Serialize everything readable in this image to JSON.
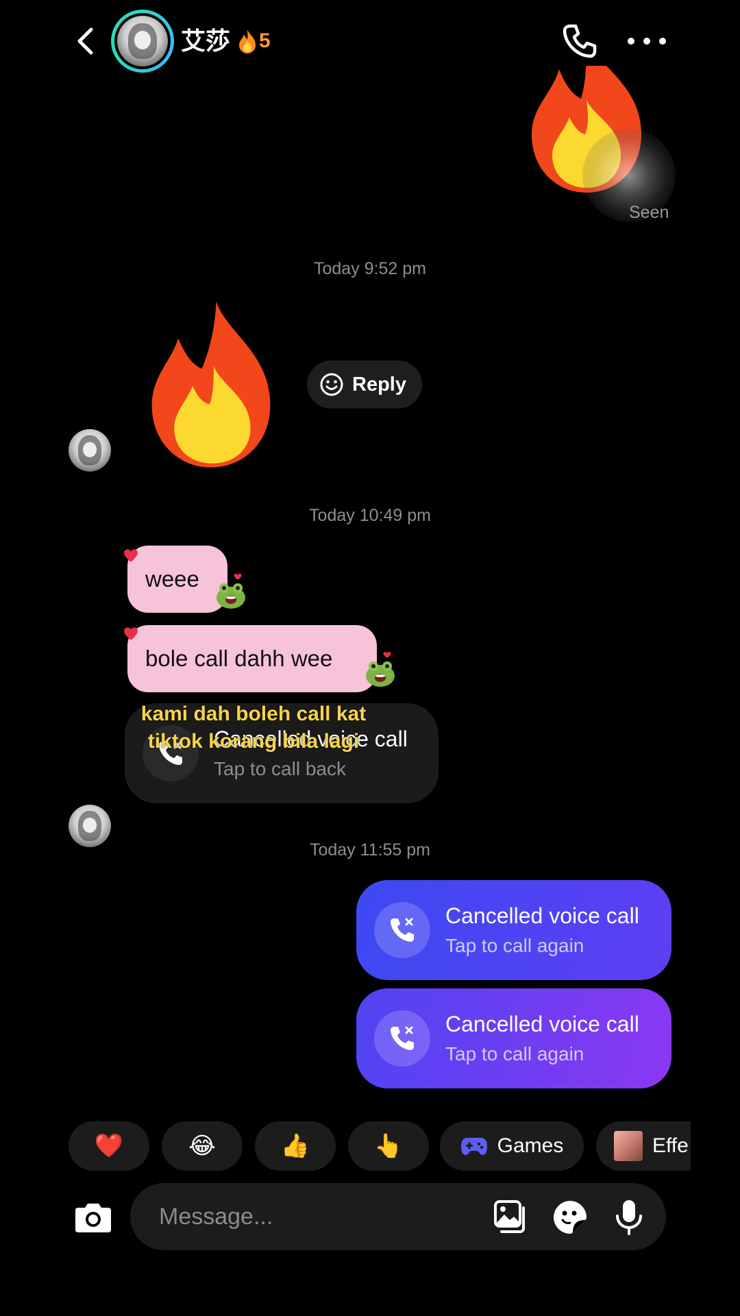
{
  "header": {
    "contact_name": "艾莎",
    "streak_count": "5",
    "icons": [
      "back-arrow",
      "avatar",
      "flame",
      "phone",
      "more-dots"
    ]
  },
  "thread": {
    "seen_label": "Seen",
    "timestamp_1": "Today 9:52 pm",
    "reply_label": "Reply",
    "timestamp_2": "Today 10:49 pm",
    "message_1": "weee",
    "message_2": "bole call dahh wee",
    "incoming_call": {
      "title": "Cancelled voice call",
      "subtitle": "Tap to call back"
    },
    "overlay_caption": "kami dah boleh call kat tiktok korang bila lagi",
    "timestamp_3": "Today 11:55 pm",
    "outgoing_calls": [
      {
        "title": "Cancelled voice call",
        "subtitle": "Tap to call again"
      },
      {
        "title": "Cancelled voice call",
        "subtitle": "Tap to call again"
      }
    ]
  },
  "quick_replies": {
    "heart": "❤️",
    "laugh": "😂",
    "thumbs_up": "👍",
    "point": "👆",
    "games_label": "Games",
    "effects_label": "Effe"
  },
  "composer": {
    "placeholder": "Message..."
  },
  "colors": {
    "background": "#000000",
    "pink_bubble": "#f6c3d9",
    "outgoing_call_start": "#3d49f2",
    "outgoing_call_end": "#8a38f2",
    "streak": "#ff9a3a",
    "avatar_ring": "#2fd8c8"
  }
}
